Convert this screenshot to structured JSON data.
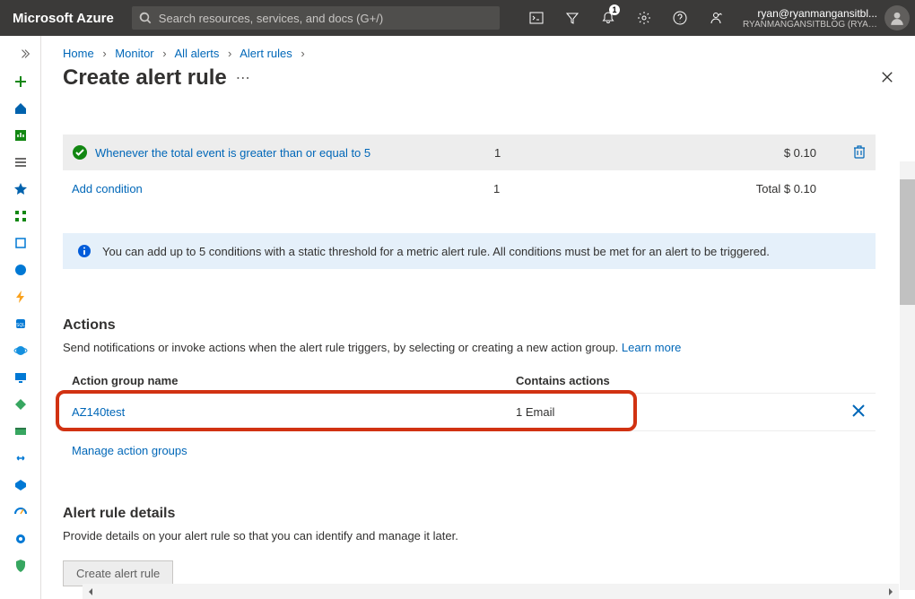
{
  "header": {
    "logo": "Microsoft Azure",
    "search_placeholder": "Search resources, services, and docs (G+/)",
    "notification_count": "1",
    "user_email": "ryan@ryanmangansitbl...",
    "tenant": "RYANMANGANSITBLOG (RYANM..."
  },
  "breadcrumb": {
    "items": [
      "Home",
      "Monitor",
      "All alerts",
      "Alert rules"
    ]
  },
  "page": {
    "title": "Create alert rule"
  },
  "condition": {
    "text": "Whenever the total event is greater than or equal to 5",
    "count": "1",
    "cost": "$ 0.10",
    "add_label": "Add condition",
    "total_count": "1",
    "total_label": "Total $ 0.10"
  },
  "info_bar": {
    "text": "You can add up to 5 conditions with a static threshold for a metric alert rule. All conditions must be met for an alert to be triggered."
  },
  "actions": {
    "heading": "Actions",
    "description": "Send notifications or invoke actions when the alert rule triggers, by selecting or creating a new action group. ",
    "learn_more": "Learn more",
    "col_name": "Action group name",
    "col_actions": "Contains actions",
    "row": {
      "name": "AZ140test",
      "contains": "1 Email"
    },
    "manage_label": "Manage action groups"
  },
  "details": {
    "heading": "Alert rule details",
    "description": "Provide details on your alert rule so that you can identify and manage it later."
  },
  "footer": {
    "create_button": "Create alert rule"
  }
}
